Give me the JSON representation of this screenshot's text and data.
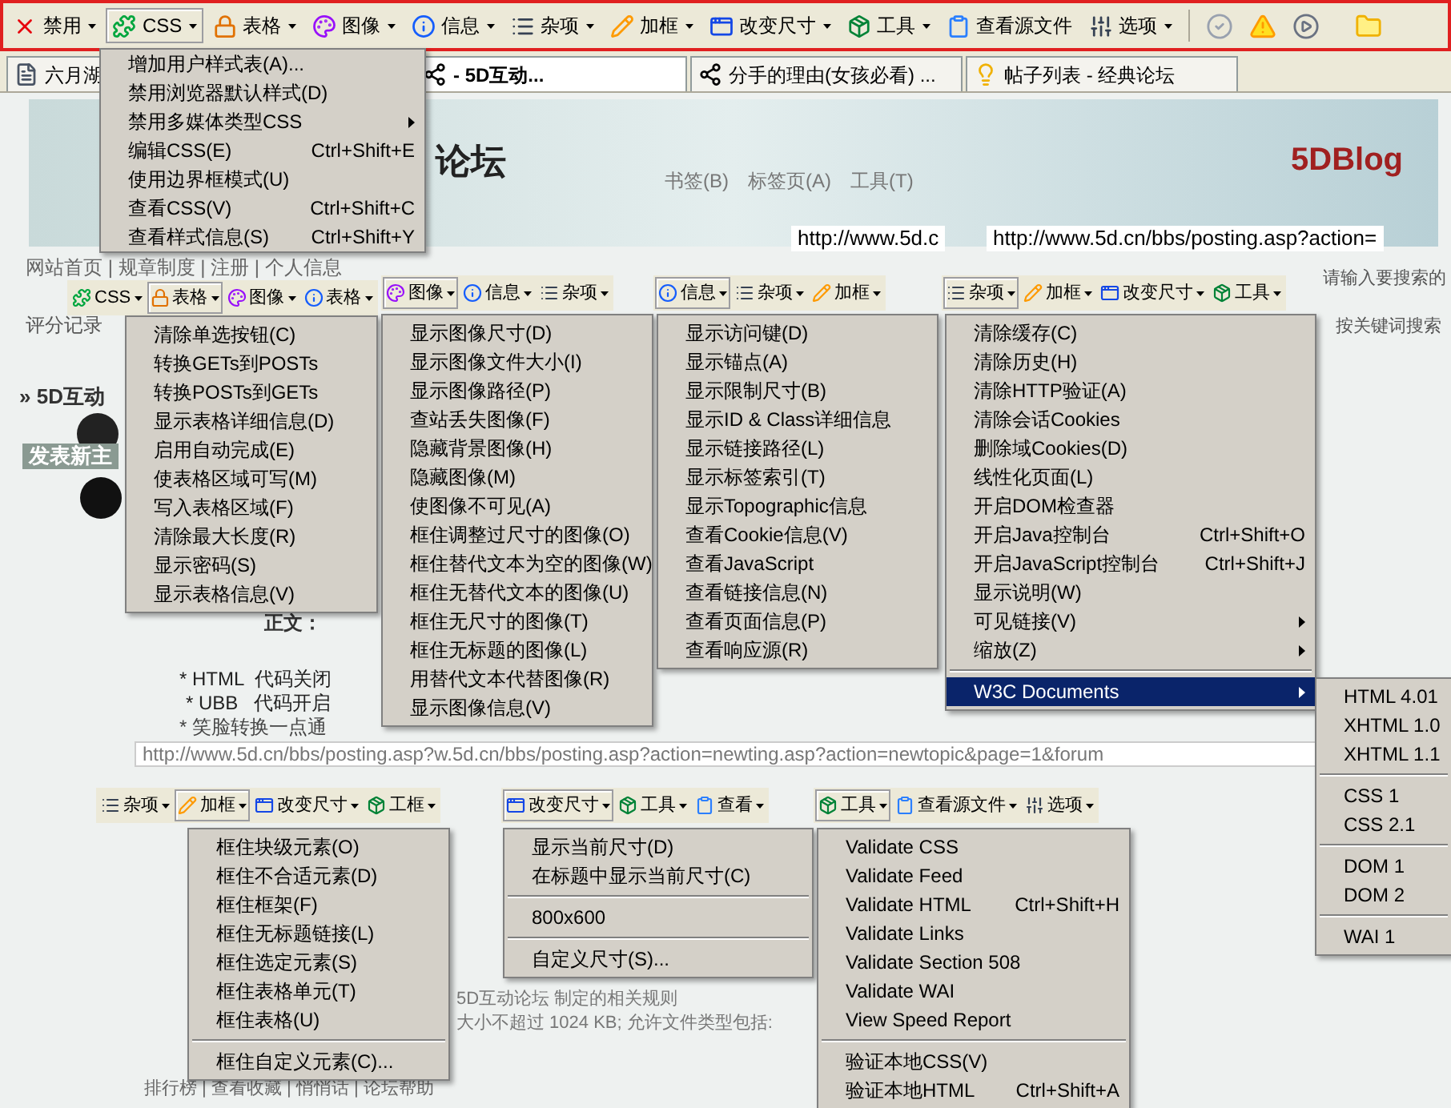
{
  "toolbar": {
    "items": [
      {
        "label": "禁用",
        "kind": "disable",
        "dropdown": true,
        "selected": false
      },
      {
        "label": "CSS",
        "kind": "css",
        "dropdown": true,
        "selected": true
      },
      {
        "label": "表格",
        "kind": "table",
        "dropdown": true,
        "selected": false
      },
      {
        "label": "图像",
        "kind": "image",
        "dropdown": true,
        "selected": false
      },
      {
        "label": "信息",
        "kind": "info",
        "dropdown": true,
        "selected": false
      },
      {
        "label": "杂项",
        "kind": "misc",
        "dropdown": true,
        "selected": false
      },
      {
        "label": "加框",
        "kind": "outline",
        "dropdown": true,
        "selected": false
      },
      {
        "label": "改变尺寸",
        "kind": "resize",
        "dropdown": true,
        "selected": false
      },
      {
        "label": "工具",
        "kind": "tools",
        "dropdown": true,
        "selected": false
      },
      {
        "label": "查看源文件",
        "kind": "source",
        "dropdown": false,
        "selected": false
      },
      {
        "label": "选项",
        "kind": "options",
        "dropdown": true,
        "selected": false
      }
    ]
  },
  "tabs": [
    {
      "label": "六月湖",
      "kind": "page",
      "selected": false
    },
    {
      "label": "- 5D互动...",
      "kind": "network",
      "selected": true
    },
    {
      "label": "分手的理由(女孩必看) ...",
      "kind": "network",
      "selected": false
    },
    {
      "label": "帖子列表 - 经典论坛",
      "kind": "bulb",
      "selected": false
    }
  ],
  "background_texts": [
    "论坛",
    "5DBlog",
    "书签(B)　标签页(A)　工具(T)",
    "http://www.5d.c",
    "http://www.5d.cn/bbs/posting.asp?action=",
    "网站首页 | 规章制度 | 注册 | 个人信息",
    "评分记录",
    "» 5D互动",
    "发表新主",
    "正文：",
    "* HTML  代码关闭",
    "* UBB   代码开启",
    "* 笑脸转换一点通",
    "http://www.5d.cn/bbs/posting.asp?w.5d.cn/bbs/posting.asp?action=newting.asp?action=newtopic&page=1&forum",
    "请输入要搜索的",
    "按关键词搜索",
    "5D互动论坛 制定的相关规则",
    "大小不超过 1024 KB; 允许文件类型包括:",
    "排行榜 | 查看收藏 | 悄悄话 | 论坛帮助"
  ],
  "css_menu": {
    "items": [
      {
        "kind": "item",
        "label": "增加用户样式表(A)..."
      },
      {
        "kind": "item",
        "label": "禁用浏览器默认样式(D)"
      },
      {
        "kind": "submenu",
        "label": "禁用多媒体类型CSS"
      },
      {
        "kind": "item",
        "label": "编辑CSS(E)",
        "shortcut": "Ctrl+Shift+E"
      },
      {
        "kind": "item",
        "label": "使用边界框模式(U)"
      },
      {
        "kind": "item",
        "label": "查看CSS(V)",
        "shortcut": "Ctrl+Shift+C"
      },
      {
        "kind": "item",
        "label": "查看样式信息(S)",
        "shortcut": "Ctrl+Shift+Y"
      }
    ]
  },
  "menus": [
    {
      "strip": [
        {
          "label": "CSS",
          "kind": "css",
          "selected": false
        },
        {
          "label": "表格",
          "kind": "table",
          "selected": true
        },
        {
          "label": "图像",
          "kind": "image",
          "selected": false
        },
        {
          "label": "表格",
          "kind": "info",
          "selected": false
        }
      ],
      "items": [
        {
          "kind": "item",
          "label": "清除单选按钮(C)"
        },
        {
          "kind": "item",
          "label": "转换GETs到POSTs"
        },
        {
          "kind": "item",
          "label": "转换POSTs到GETs"
        },
        {
          "kind": "item",
          "label": "显示表格详细信息(D)"
        },
        {
          "kind": "item",
          "label": "启用自动完成(E)"
        },
        {
          "kind": "item",
          "label": "使表格区域可写(M)"
        },
        {
          "kind": "item",
          "label": "写入表格区域(F)"
        },
        {
          "kind": "item",
          "label": "清除最大长度(R)"
        },
        {
          "kind": "item",
          "label": "显示密码(S)"
        },
        {
          "kind": "item",
          "label": "显示表格信息(V)"
        }
      ]
    },
    {
      "strip": [
        {
          "label": "图像",
          "kind": "image",
          "selected": true
        },
        {
          "label": "信息",
          "kind": "info",
          "selected": false
        },
        {
          "label": "杂项",
          "kind": "misc",
          "selected": false
        }
      ],
      "items": [
        {
          "kind": "item",
          "label": "显示图像尺寸(D)"
        },
        {
          "kind": "item",
          "label": "显示图像文件大小(I)"
        },
        {
          "kind": "item",
          "label": "显示图像路径(P)"
        },
        {
          "kind": "item",
          "label": "查站丢失图像(F)"
        },
        {
          "kind": "item",
          "label": "隐藏背景图像(H)"
        },
        {
          "kind": "item",
          "label": "隐藏图像(M)"
        },
        {
          "kind": "item",
          "label": "使图像不可见(A)"
        },
        {
          "kind": "item",
          "label": "框住调整过尺寸的图像(O)"
        },
        {
          "kind": "item",
          "label": "框住替代文本为空的图像(W)"
        },
        {
          "kind": "item",
          "label": "框住无替代文本的图像(U)"
        },
        {
          "kind": "item",
          "label": "框住无尺寸的图像(T)"
        },
        {
          "kind": "item",
          "label": "框住无标题的图像(L)"
        },
        {
          "kind": "item",
          "label": "用替代文本代替图像(R)"
        },
        {
          "kind": "item",
          "label": "显示图像信息(V)"
        }
      ]
    },
    {
      "strip": [
        {
          "label": "信息",
          "kind": "info",
          "selected": true
        },
        {
          "label": "杂项",
          "kind": "misc",
          "selected": false
        },
        {
          "label": "加框",
          "kind": "outline",
          "selected": false
        }
      ],
      "items": [
        {
          "kind": "item",
          "label": "显示访问键(D)"
        },
        {
          "kind": "item",
          "label": "显示锚点(A)"
        },
        {
          "kind": "item",
          "label": "显示限制尺寸(B)"
        },
        {
          "kind": "item",
          "label": "显示ID & Class详细信息"
        },
        {
          "kind": "item",
          "label": "显示链接路径(L)"
        },
        {
          "kind": "item",
          "label": "显示标签索引(T)"
        },
        {
          "kind": "item",
          "label": "显示Topographic信息"
        },
        {
          "kind": "item",
          "label": "查看Cookie信息(V)"
        },
        {
          "kind": "item",
          "label": "查看JavaScript"
        },
        {
          "kind": "item",
          "label": "查看链接信息(N)"
        },
        {
          "kind": "item",
          "label": "查看页面信息(P)"
        },
        {
          "kind": "item",
          "label": "查看响应源(R)"
        }
      ]
    },
    {
      "strip": [
        {
          "label": "杂项",
          "kind": "misc",
          "selected": true
        },
        {
          "label": "加框",
          "kind": "outline",
          "selected": false
        },
        {
          "label": "改变尺寸",
          "kind": "resize",
          "selected": false
        },
        {
          "label": "工具",
          "kind": "tools",
          "selected": false
        }
      ],
      "items": [
        {
          "kind": "item",
          "label": "清除缓存(C)",
          "highlighted": false
        },
        {
          "kind": "item",
          "label": "清除历史(H)",
          "highlighted": false
        },
        {
          "kind": "item",
          "label": "清除HTTP验证(A)",
          "highlighted": false
        },
        {
          "kind": "item",
          "label": "清除会话Cookies",
          "highlighted": false
        },
        {
          "kind": "item",
          "label": "删除域Cookies(D)",
          "highlighted": false
        },
        {
          "kind": "item",
          "label": "线性化页面(L)",
          "highlighted": false
        },
        {
          "kind": "item",
          "label": "开启DOM检查器",
          "highlighted": false
        },
        {
          "kind": "item",
          "label": "开启Java控制台",
          "shortcut": "Ctrl+Shift+O",
          "highlighted": false
        },
        {
          "kind": "item",
          "label": "开启JavaScript控制台",
          "shortcut": "Ctrl+Shift+J",
          "highlighted": false
        },
        {
          "kind": "item",
          "label": "显示说明(W)",
          "highlighted": false
        },
        {
          "kind": "submenu",
          "label": "可见链接(V)",
          "highlighted": false
        },
        {
          "kind": "submenu",
          "label": "缩放(Z)",
          "highlighted": false
        },
        {
          "kind": "separator"
        },
        {
          "kind": "submenu",
          "label": "W3C Documents",
          "highlighted": true,
          "children": [
            {
              "kind": "item",
              "label": "HTML 4.01"
            },
            {
              "kind": "item",
              "label": "XHTML 1.0"
            },
            {
              "kind": "item",
              "label": "XHTML 1.1"
            },
            {
              "kind": "separator"
            },
            {
              "kind": "item",
              "label": "CSS 1"
            },
            {
              "kind": "item",
              "label": "CSS 2.1"
            },
            {
              "kind": "separator"
            },
            {
              "kind": "item",
              "label": "DOM 1"
            },
            {
              "kind": "item",
              "label": "DOM 2"
            },
            {
              "kind": "separator"
            },
            {
              "kind": "item",
              "label": "WAI 1"
            }
          ]
        }
      ]
    },
    {
      "strip": [
        {
          "label": "杂项",
          "kind": "misc",
          "selected": false
        },
        {
          "label": "加框",
          "kind": "outline",
          "selected": true
        },
        {
          "label": "改变尺寸",
          "kind": "resize",
          "selected": false
        },
        {
          "label": "工框",
          "kind": "tools",
          "selected": false
        }
      ],
      "items": [
        {
          "kind": "item",
          "label": "框住块级元素(O)"
        },
        {
          "kind": "item",
          "label": "框住不合适元素(D)"
        },
        {
          "kind": "item",
          "label": "框住框架(F)"
        },
        {
          "kind": "item",
          "label": "框住无标题链接(L)"
        },
        {
          "kind": "item",
          "label": "框住选定元素(S)"
        },
        {
          "kind": "item",
          "label": "框住表格单元(T)"
        },
        {
          "kind": "item",
          "label": "框住表格(U)"
        },
        {
          "kind": "separator"
        },
        {
          "kind": "item",
          "label": "框住自定义元素(C)..."
        }
      ]
    },
    {
      "strip": [
        {
          "label": "改变尺寸",
          "kind": "resize",
          "selected": true
        },
        {
          "label": "工具",
          "kind": "tools",
          "selected": false
        },
        {
          "label": "查看",
          "kind": "source",
          "selected": false
        }
      ],
      "items": [
        {
          "kind": "item",
          "label": "显示当前尺寸(D)"
        },
        {
          "kind": "item",
          "label": "在标题中显示当前尺寸(C)"
        },
        {
          "kind": "separator"
        },
        {
          "kind": "item",
          "label": "800x600"
        },
        {
          "kind": "separator"
        },
        {
          "kind": "item",
          "label": "自定义尺寸(S)..."
        }
      ]
    },
    {
      "strip": [
        {
          "label": "工具",
          "kind": "tools",
          "selected": true
        },
        {
          "label": "查看源文件",
          "kind": "source",
          "selected": false
        },
        {
          "label": "选项",
          "kind": "options",
          "selected": false
        }
      ],
      "items": [
        {
          "kind": "item",
          "label": "Validate CSS"
        },
        {
          "kind": "item",
          "label": "Validate Feed"
        },
        {
          "kind": "item",
          "label": "Validate HTML",
          "shortcut": "Ctrl+Shift+H"
        },
        {
          "kind": "item",
          "label": "Validate Links"
        },
        {
          "kind": "item",
          "label": "Validate Section 508"
        },
        {
          "kind": "item",
          "label": "Validate WAI"
        },
        {
          "kind": "item",
          "label": "View Speed Report"
        },
        {
          "kind": "separator"
        },
        {
          "kind": "item",
          "label": "验证本地CSS(V)"
        },
        {
          "kind": "item",
          "label": "验证本地HTML",
          "shortcut": "Ctrl+Shift+A"
        }
      ]
    }
  ]
}
